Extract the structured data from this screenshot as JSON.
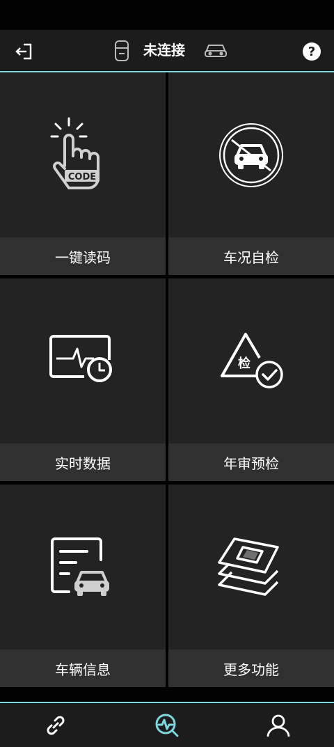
{
  "header": {
    "title": "未连接",
    "icons": [
      "exit-icon",
      "vci-device-icon",
      "car-icon",
      "help-icon"
    ]
  },
  "tiles": [
    {
      "label": "一键读码",
      "icon": "tap-code-icon",
      "icon_text": "CODE"
    },
    {
      "label": "车况自检",
      "icon": "car-self-check-icon"
    },
    {
      "label": "实时数据",
      "icon": "realtime-data-icon"
    },
    {
      "label": "年审预检",
      "icon": "inspection-precheck-icon",
      "icon_text": "检"
    },
    {
      "label": "车辆信息",
      "icon": "vehicle-info-icon"
    },
    {
      "label": "更多功能",
      "icon": "more-functions-icon"
    }
  ],
  "tabbar": {
    "tabs": [
      {
        "name": "connect",
        "icon": "link-icon",
        "active": false
      },
      {
        "name": "diagnose",
        "icon": "diagnose-search-icon",
        "active": true
      },
      {
        "name": "profile",
        "icon": "user-icon",
        "active": false
      }
    ]
  },
  "colors": {
    "accent": "#7fd8de",
    "tile_bg": "#232323",
    "label_bg": "#303030",
    "header_bg": "#1c1c1c"
  }
}
